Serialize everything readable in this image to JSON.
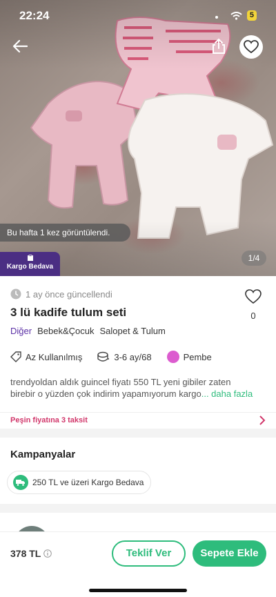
{
  "status_bar": {
    "time": "22:24",
    "battery": "5"
  },
  "hero": {
    "views_text": "Bu hafta 1 kez görüntülendi.",
    "cargo_badge": "Kargo Bedava",
    "page_indicator": "1/4"
  },
  "product": {
    "updated": "1 ay önce güncellendi",
    "title": "3 lü kadife tulum seti",
    "like_count": "0",
    "categories": [
      "Diğer",
      "Bebek&Çocuk",
      "Salopet & Tulum"
    ],
    "condition": "Az Kullanılmış",
    "size": "3-6 ay/68",
    "color_name": "Pembe",
    "color_hex": "#dc5ccf",
    "description_line1": "trendyoldan aldık guincel fiyatı 550 TL yeni gibiler zaten",
    "description_line2": "birebir o yüzden çok indirim yapamıyorum kargo",
    "description_more": "... daha fazla"
  },
  "installment": {
    "label": "Peşin fiyatına 3 taksit"
  },
  "campaigns": {
    "title": "Kampanyalar",
    "items": [
      "250 TL ve üzeri Kargo Bedava"
    ]
  },
  "bottom_bar": {
    "price": "378 TL",
    "offer_label": "Teklif Ver",
    "cart_label": "Sepete Ekle"
  },
  "colors": {
    "accent": "#2ebc7c",
    "brand_purple": "#4b2e83",
    "installment": "#d1366a"
  }
}
